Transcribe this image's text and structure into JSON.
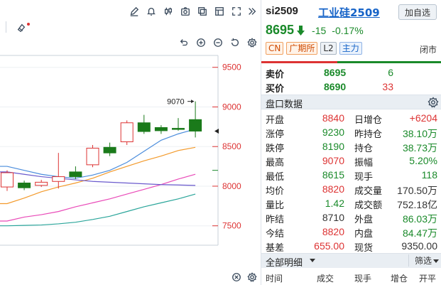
{
  "chart": {
    "price_annotation": "9070",
    "y_ticks": [
      "9500",
      "9000",
      "8500",
      "8000",
      "7500"
    ]
  },
  "chart_data": {
    "type": "candlestick",
    "ylim": [
      7300,
      9650
    ],
    "y_ticks": [
      9500,
      9000,
      8500,
      8000,
      7500
    ],
    "candles": [
      {
        "open": 7990,
        "close": 8170,
        "high": 8200,
        "low": 7940
      },
      {
        "open": 8040,
        "close": 7980,
        "high": 8070,
        "low": 7950
      },
      {
        "open": 8010,
        "close": 8050,
        "high": 8080,
        "low": 7990
      },
      {
        "open": 8060,
        "close": 8120,
        "high": 8420,
        "low": 7970
      },
      {
        "open": 8180,
        "close": 8120,
        "high": 8250,
        "low": 8090
      },
      {
        "open": 8270,
        "close": 8480,
        "high": 8520,
        "low": 8240
      },
      {
        "open": 8490,
        "close": 8420,
        "high": 8550,
        "low": 8380
      },
      {
        "open": 8560,
        "close": 8800,
        "high": 8830,
        "low": 8520
      },
      {
        "open": 8800,
        "close": 8690,
        "high": 8900,
        "low": 8660
      },
      {
        "open": 8740,
        "close": 8700,
        "high": 8770,
        "low": 8660
      },
      {
        "open": 8730,
        "close": 8720,
        "high": 8860,
        "low": 8700
      },
      {
        "open": 8840,
        "close": 8695,
        "high": 9070,
        "low": 8615
      }
    ],
    "ma": [
      {
        "color": "#4a8cdc",
        "values": [
          8250,
          8200,
          8150,
          8120,
          8100,
          8140,
          8200,
          8300,
          8440,
          8580,
          8660,
          8720
        ]
      },
      {
        "color": "#f39a2b",
        "values": [
          7780,
          7850,
          7930,
          7990,
          8040,
          8100,
          8180,
          8250,
          8320,
          8380,
          8450,
          8490
        ]
      },
      {
        "color": "#e94ab8",
        "values": [
          7560,
          7610,
          7640,
          7680,
          7740,
          7790,
          7840,
          7900,
          7960,
          8020,
          8090,
          8150
        ]
      },
      {
        "color": "#2aa59a",
        "values": [
          7500,
          7505,
          7510,
          7525,
          7545,
          7580,
          7620,
          7680,
          7740,
          7790,
          7840,
          7900
        ]
      },
      {
        "color": "#6a5acd",
        "values": [
          8180,
          8150,
          8120,
          8100,
          8080,
          8060,
          8050,
          8040,
          8030,
          8020,
          8015,
          8010
        ]
      }
    ],
    "last_price_marker": 8695
  },
  "quote": {
    "code": "si2509",
    "name": "工业硅2509",
    "add_watch_label": "加自选",
    "price": "8695",
    "change": "-15",
    "change_pct": "-0.17%",
    "tags": [
      "CN",
      "广期所",
      "L2",
      "主力"
    ],
    "status": "闭市",
    "sell_label": "卖价",
    "sell_price": "8695",
    "sell_qty": "6",
    "buy_label": "买价",
    "buy_price": "8690",
    "buy_qty": "33",
    "section_title": "盘口数据",
    "stats": [
      {
        "l1": "开盘",
        "v1": "8840",
        "c1": "red",
        "l2": "日增仓",
        "v2": "+6204",
        "c2": "red"
      },
      {
        "l1": "涨停",
        "v1": "9230",
        "c1": "green",
        "l2": "昨持仓",
        "v2": "38.10万",
        "c2": "green"
      },
      {
        "l1": "跌停",
        "v1": "8190",
        "c1": "green",
        "l2": "持仓",
        "v2": "38.73万",
        "c2": "green"
      },
      {
        "l1": "最高",
        "v1": "9070",
        "c1": "red",
        "l2": "振幅",
        "v2": "5.20%",
        "c2": "green"
      },
      {
        "l1": "最低",
        "v1": "8615",
        "c1": "green",
        "l2": "现手",
        "v2": "118",
        "c2": "green"
      },
      {
        "l1": "均价",
        "v1": "8820",
        "c1": "red",
        "l2": "成交量",
        "v2": "170.50万",
        "c2": "dark"
      },
      {
        "l1": "量比",
        "v1": "1.42",
        "c1": "green",
        "l2": "成交额",
        "v2": "752.18亿",
        "c2": "dark"
      },
      {
        "l1": "昨结",
        "v1": "8710",
        "c1": "dark",
        "l2": "外盘",
        "v2": "86.03万",
        "c2": "green"
      },
      {
        "l1": "今结",
        "v1": "8820",
        "c1": "red",
        "l2": "内盘",
        "v2": "84.47万",
        "c2": "green"
      },
      {
        "l1": "基差",
        "v1": "655.00",
        "c1": "red",
        "l2": "现货",
        "v2": "9350.00",
        "c2": "dark"
      }
    ],
    "detail_title": "全部明细",
    "filter_label": "筛选",
    "columns": [
      "时间",
      "成交",
      "现手",
      "增仓",
      "开平"
    ]
  },
  "colors": {
    "up": "#d33",
    "down": "#1a8a2a",
    "accent": "#1764c8"
  },
  "icons": [
    "pen-icon",
    "bell-icon",
    "candle-icon",
    "camera-icon",
    "copy-icon",
    "layout-icon",
    "fullscreen-icon",
    "collapse-icon",
    "eraser-icon",
    "undo-icon",
    "zoom-in-icon",
    "zoom-out-icon",
    "settings-icon"
  ]
}
